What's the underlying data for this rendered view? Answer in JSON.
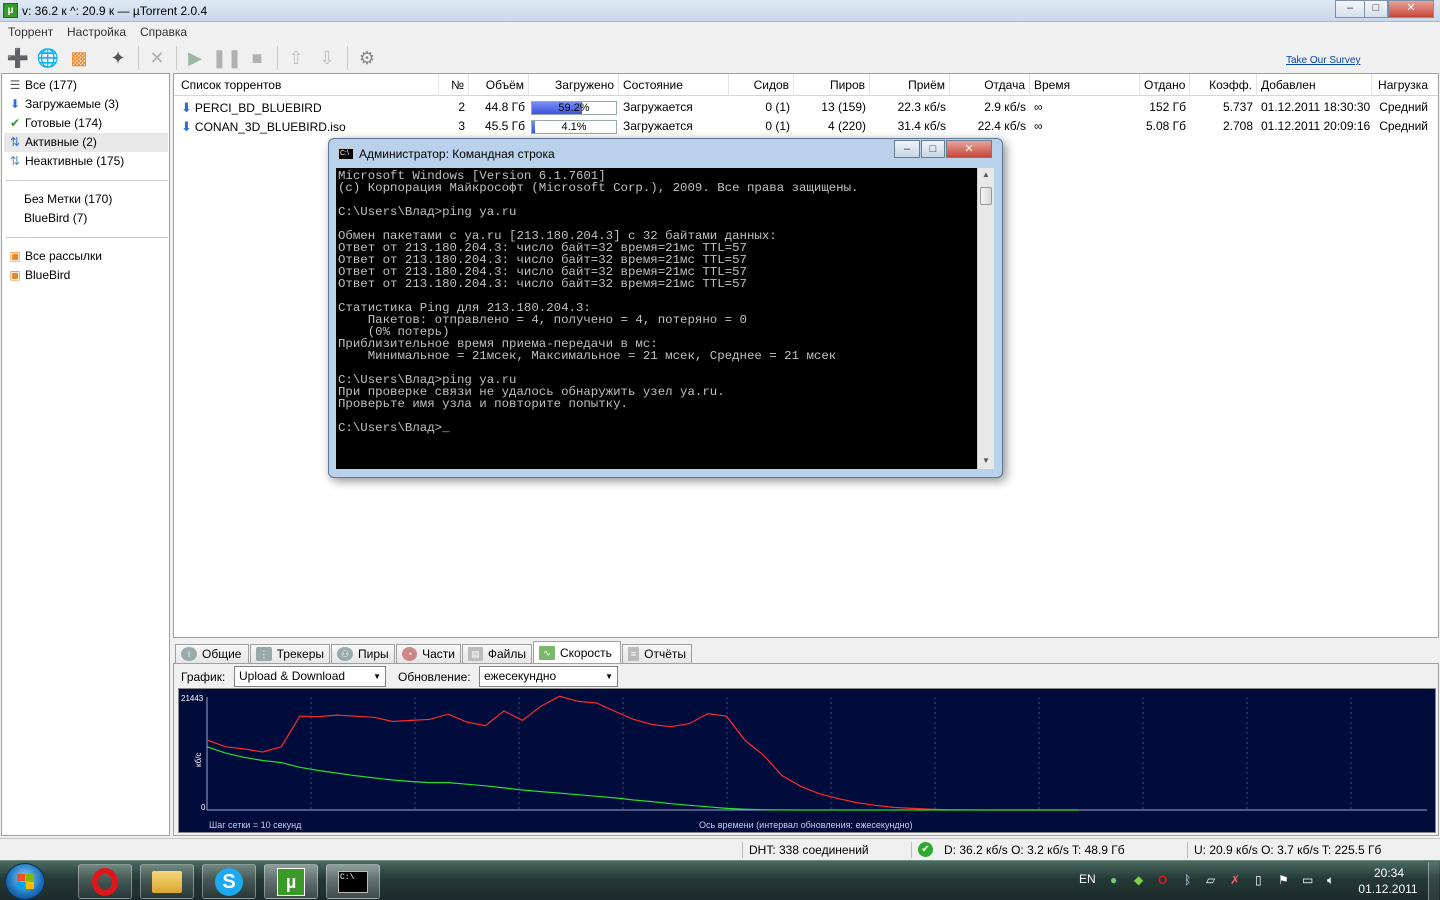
{
  "window": {
    "title": "v: 36.2 к ^: 20.9 к — µTorrent 2.0.4",
    "app_icon": "µ"
  },
  "menu": [
    "Торрент",
    "Настройка",
    "Справка"
  ],
  "toolbar": {
    "survey_link": "Take Our Survey"
  },
  "sidebar": {
    "status_items": [
      {
        "label": "Все (177)",
        "icon": "list-icon"
      },
      {
        "label": "Загружаемые (3)",
        "icon": "download-arrow-icon"
      },
      {
        "label": "Готовые (174)",
        "icon": "checkmark-icon"
      },
      {
        "label": "Активные (2)",
        "icon": "updown-arrows-icon",
        "selected": true
      },
      {
        "label": "Неактивные (175)",
        "icon": "updown-arrows-icon"
      }
    ],
    "labels": [
      "Без Метки (170)",
      "BlueBird (7)"
    ],
    "feeds": [
      "Все рассылки",
      "BlueBird"
    ]
  },
  "list": {
    "columns": [
      "Список торрентов",
      "№",
      "Объём",
      "Загружено",
      "Состояние",
      "Сидов",
      "Пиров",
      "Приём",
      "Отдача",
      "Время",
      "Отдано",
      "Коэфф.",
      "Добавлен",
      "Нагрузка"
    ],
    "rows": [
      {
        "name": "PERCI_BD_BLUEBIRD",
        "num": "2",
        "size": "44.8 Гб",
        "done": "59.2%",
        "progress": 0.592,
        "status": "Загружается",
        "seeds": "0 (1)",
        "peers": "13 (159)",
        "down": "22.3 кб/s",
        "up": "2.9 кб/s",
        "eta": "∞",
        "uploaded": "152 Гб",
        "ratio": "5.737",
        "added": "01.12.2011 18:30:30",
        "load": "Средний"
      },
      {
        "name": "CONAN_3D_BLUEBIRD.iso",
        "num": "3",
        "size": "45.5 Гб",
        "done": "4.1%",
        "progress": 0.041,
        "status": "Загружается",
        "seeds": "0 (1)",
        "peers": "4 (220)",
        "down": "31.4 кб/s",
        "up": "22.4 кб/s",
        "eta": "∞",
        "uploaded": "5.08 Гб",
        "ratio": "2.708",
        "added": "01.12.2011 20:09:16",
        "load": "Средний"
      }
    ]
  },
  "tabs": [
    "Общие",
    "Трекеры",
    "Пиры",
    "Части",
    "Файлы",
    "Скорость",
    "Отчёты"
  ],
  "active_tab": "Скорость",
  "graph_panel": {
    "graph_label": "График:",
    "graph_value": "Upload & Download",
    "update_label": "Обновление:",
    "update_value": "ежесекундно",
    "ymax": "21443",
    "ymin": "0",
    "yunit": "кб/с",
    "grid_note": "Шаг сетки = 10 секунд",
    "axis_note": "Ось времени (интервал обновления: ежесекундно)"
  },
  "status_bar": {
    "dht": "DHT: 338 соединений",
    "down": "D: 36.2 кб/s O: 3.2 кб/s T: 48.9 Гб",
    "up": "U: 20.9 кб/s O: 3.7 кб/s T: 225.5 Гб"
  },
  "cmd": {
    "title": "Администратор: Командная строка",
    "icon": "C:\\",
    "text": "Microsoft Windows [Version 6.1.7601]\n(c) Корпорация Майкрософт (Microsoft Corp.), 2009. Все права защищены.\n\nC:\\Users\\Влад>ping ya.ru\n\nОбмен пакетами с ya.ru [213.180.204.3] с 32 байтами данных:\nОтвет от 213.180.204.3: число байт=32 время=21мс TTL=57\nОтвет от 213.180.204.3: число байт=32 время=21мс TTL=57\nОтвет от 213.180.204.3: число байт=32 время=21мс TTL=57\nОтвет от 213.180.204.3: число байт=32 время=21мс TTL=57\n\nСтатистика Ping для 213.180.204.3:\n    Пакетов: отправлено = 4, получено = 4, потеряно = 0\n    (0% потерь)\nПриблизительное время приема-передачи в мс:\n    Минимальное = 21мсек, Максимальное = 21 мсек, Среднее = 21 мсек\n\nC:\\Users\\Влад>ping ya.ru\nПри проверке связи не удалось обнаружить узел ya.ru.\nПроверьте имя узла и повторите попытку.\n\nC:\\Users\\Влад>_"
  },
  "taskbar": {
    "lang": "EN",
    "time": "20:34",
    "date": "01.12.2011",
    "cmd_thumb": "C:\\"
  },
  "colors": {
    "graph_bg": "#000c3c",
    "download_line": "#ff2a2a",
    "upload_line": "#2ddc2d",
    "grid": "#3a4a8a"
  },
  "chart_data": {
    "type": "line",
    "ylabel": "кб/с",
    "ylim": [
      0,
      21443
    ],
    "series": [
      {
        "values": [
          13300,
          12000,
          11600,
          11000,
          12000,
          17800,
          17700,
          18000,
          17800,
          17600,
          16800,
          17000,
          17200,
          18200,
          16700,
          16000,
          18800,
          17000,
          19700,
          21600,
          20600,
          20300,
          18700,
          17200,
          16200,
          15800,
          16400,
          18300,
          17800,
          13200,
          10400,
          6500,
          4500,
          3100,
          2200,
          1400,
          900,
          500,
          300,
          150,
          60,
          20,
          0,
          0,
          0,
          0,
          0,
          0
        ]
      },
      {
        "values": [
          12000,
          10800,
          10000,
          9400,
          9000,
          8100,
          7500,
          7000,
          6500,
          6100,
          5700,
          5400,
          5200,
          5200,
          4900,
          4600,
          4200,
          3800,
          3500,
          3200,
          2900,
          2600,
          2300,
          1900,
          1600,
          1200,
          900,
          600,
          300,
          150,
          60,
          20,
          0,
          0,
          0,
          0,
          0,
          0,
          0,
          0,
          0,
          0,
          0,
          0,
          0,
          0,
          0,
          0
        ]
      }
    ]
  }
}
